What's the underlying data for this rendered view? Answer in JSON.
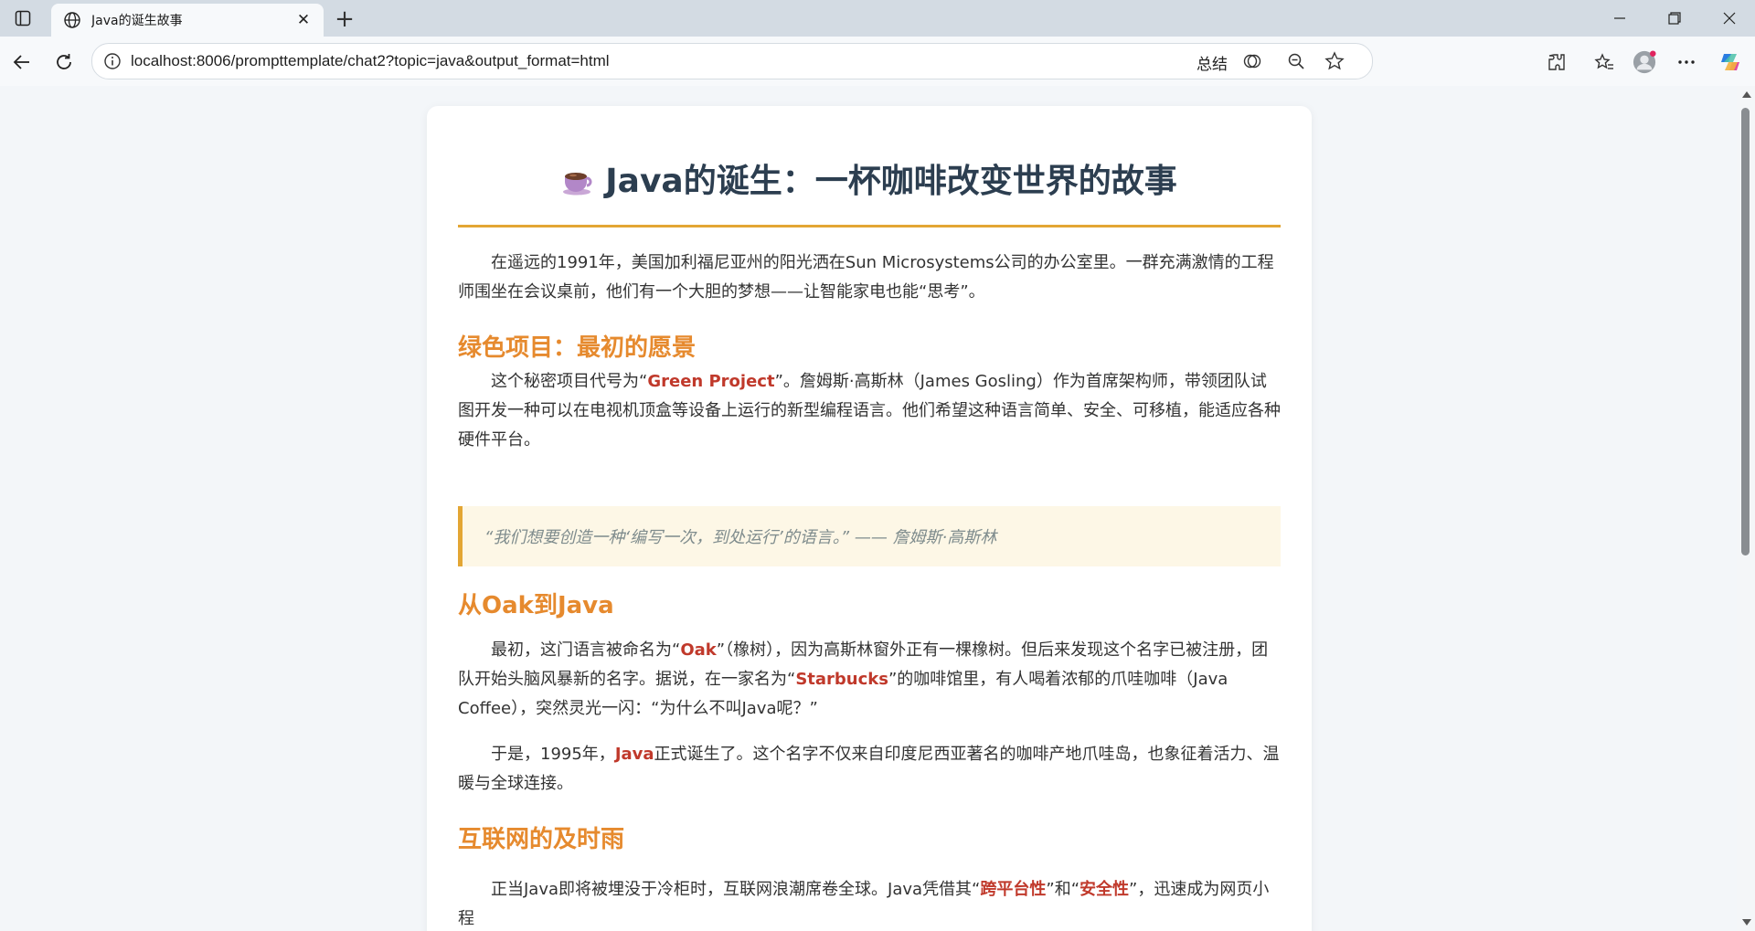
{
  "browser": {
    "tab_title": "Java的诞生故事",
    "url": "localhost:8006/prompttemplate/chat2?topic=java&output_format=html",
    "summary_label": "总结"
  },
  "article": {
    "title": "Java的诞生：一杯咖啡改变世界的故事",
    "intro": "在遥远的1991年，美国加利福尼亚州的阳光洒在Sun Microsystems公司的办公室里。一群充满激情的工程师围坐在会议桌前，他们有一个大胆的梦想——让智能家电也能“思考”。",
    "section1": {
      "heading": "绿色项目：最初的愿景",
      "p_before": "这个秘密项目代号为“",
      "p_highlight": "Green Project",
      "p_after": "”。詹姆斯·高斯林（James Gosling）作为首席架构师，带领团队试图开发一种可以在电视机顶盒等设备上运行的新型编程语言。他们希望这种语言简单、安全、可移植，能适应各种硬件平台。",
      "quote": "“我们想要创造一种‘编写一次，到处运行’的语言。” —— 詹姆斯·高斯林"
    },
    "section2": {
      "heading": "从Oak到Java",
      "p1_a": "最初，这门语言被命名为“",
      "p1_hl1": "Oak",
      "p1_b": "”（橡树），因为高斯林窗外正有一棵橡树。但后来发现这个名字已被注册，团队开始头脑风暴新的名字。据说，在一家名为“",
      "p1_hl2": "Starbucks",
      "p1_c": "”的咖啡馆里，有人喝着浓郁的爪哇咖啡（Java Coffee），突然灵光一闪：“为什么不叫Java呢？”",
      "p2_a": "于是，1995年，",
      "p2_hl": "Java",
      "p2_b": "正式诞生了。这个名字不仅来自印度尼西亚著名的咖啡产地爪哇岛，也象征着活力、温暖与全球连接。"
    },
    "section3": {
      "heading": "互联网的及时雨",
      "p_a": "正当Java即将被埋没于冷柜时，互联网浪潮席卷全球。Java凭借其“",
      "p_hl1": "跨平台性",
      "p_b": "”和“",
      "p_hl2": "安全性",
      "p_c": "”，迅速成为网页小程"
    }
  },
  "colors": {
    "title": "#2c3e50",
    "heading": "#e68a2e",
    "highlight": "#c0392b",
    "rule": "#e3a634"
  }
}
